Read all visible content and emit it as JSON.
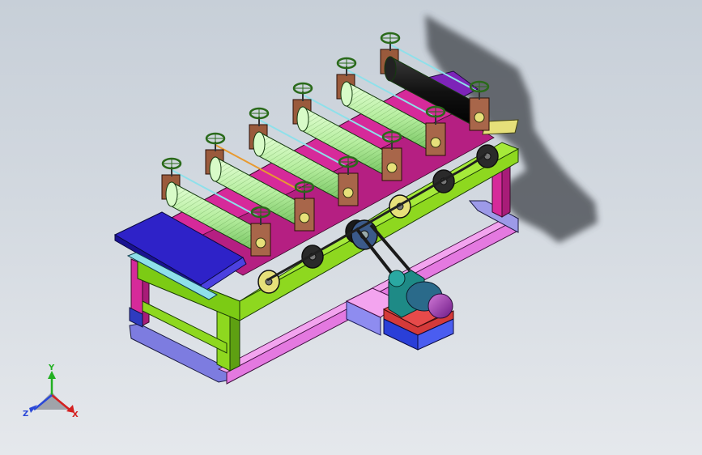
{
  "viewport": {
    "background_top": "#c7cfd8",
    "background_bottom": "#e5e8ec"
  },
  "model": {
    "roller_count": 6,
    "colors": {
      "frame_green": "#8ed81f",
      "frame_magenta": "#d62a9a",
      "leg_blue": "#7d7ce0",
      "feed_table": "#2e22c8",
      "roller_light": "#b9f2a8",
      "roller_dark": "#111111",
      "bracket_brown": "#9a5a3c",
      "sprocket_yellow": "#e6e07a",
      "motor_purple": "#9a2bb3",
      "gearbox_teal": "#1e8a86",
      "motor_base_blue": "#2a3fd8",
      "motor_base_red": "#d43a3a"
    }
  },
  "triad": {
    "x_label": "X",
    "y_label": "Y",
    "z_label": "Z",
    "x_color": "#d42020",
    "y_color": "#22b022",
    "z_color": "#2a48d8"
  }
}
